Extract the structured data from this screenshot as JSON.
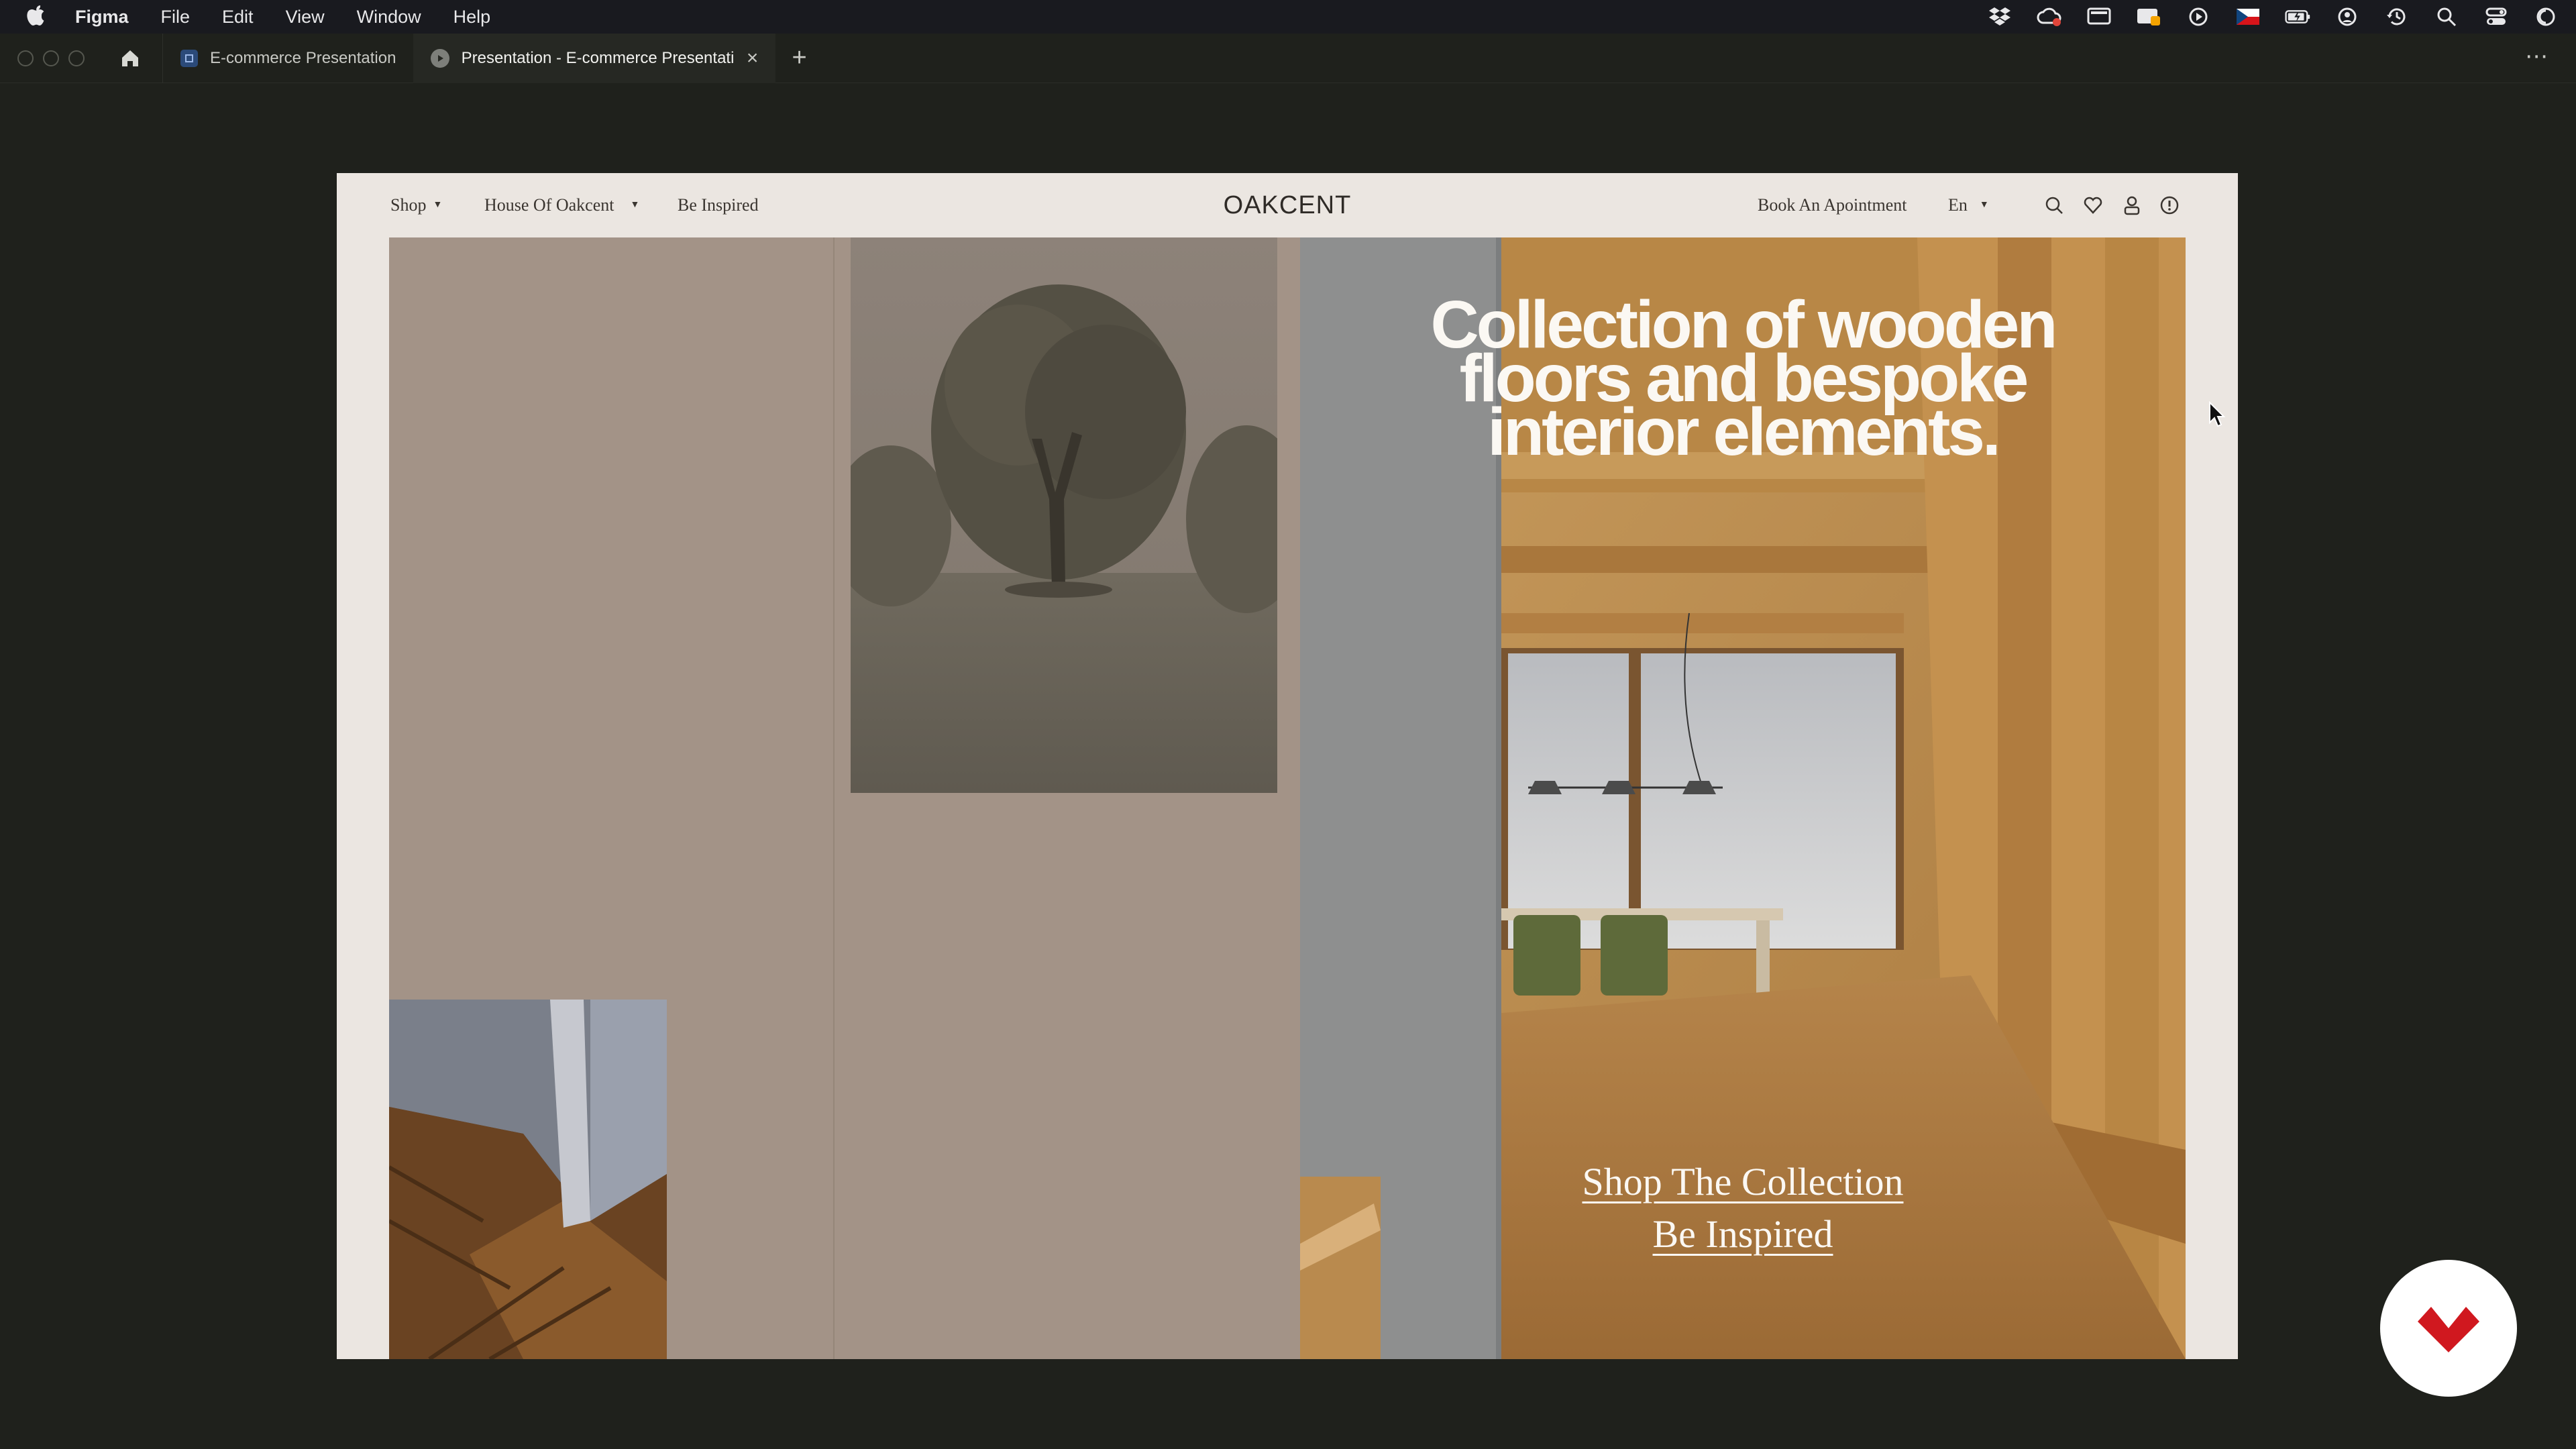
{
  "menubar": {
    "app_name": "Figma",
    "items": [
      "File",
      "Edit",
      "View",
      "Window",
      "Help"
    ]
  },
  "tabs": {
    "tab1_label": "E-commerce Presentation",
    "tab2_label": "Presentation - E-commerce Presentatio",
    "new_tab_symbol": "+",
    "more_symbol": "⋯"
  },
  "site": {
    "nav": {
      "shop": "Shop",
      "house": "House Of Oakcent",
      "inspired": "Be Inspired",
      "logo": "OAKCENT",
      "appointment": "Book An Apointment",
      "lang": "En"
    },
    "hero": {
      "title_line1": "Collection of wooden",
      "title_line2": "floors and bespoke",
      "title_line3": "interior elements.",
      "link_shop": "Shop The Collection",
      "link_inspired": "Be Inspired"
    }
  },
  "colors": {
    "panel": "#a39387",
    "frame_bg": "#ebe6e1",
    "accent_badge": "#d0181f"
  },
  "icons": [
    "apple-icon",
    "dropbox-icon",
    "creative-cloud-icon",
    "display-icon",
    "screen-share-icon",
    "play-icon",
    "flag-cz-icon",
    "battery-icon",
    "user-icon",
    "time-machine-icon",
    "spotlight-icon",
    "control-center-icon",
    "siri-icon",
    "home-icon",
    "search-icon",
    "heart-icon",
    "account-icon",
    "info-icon"
  ]
}
